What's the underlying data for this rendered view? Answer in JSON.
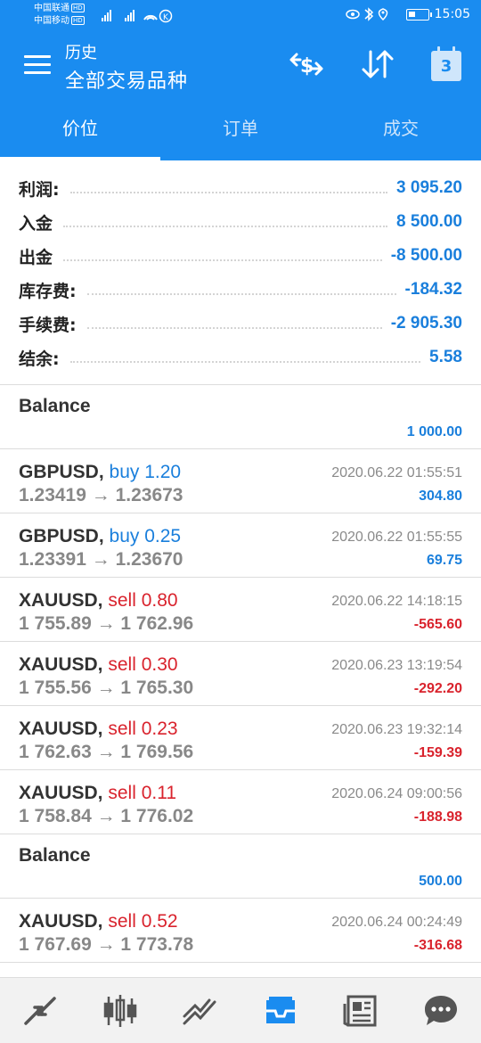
{
  "status_bar": {
    "carrier1": "中国联通",
    "carrier2": "中国移动",
    "hd": "HD",
    "time": "15:05"
  },
  "header": {
    "subtitle": "历史",
    "title": "全部交易品种",
    "calendar_day": "3",
    "icons": [
      "menu-icon",
      "symbols-exchange-icon",
      "sort-icon",
      "calendar-icon"
    ]
  },
  "tabs": [
    "价位",
    "订单",
    "成交"
  ],
  "summary": [
    {
      "label": "利润:",
      "value": "3 095.20"
    },
    {
      "label": "入金",
      "value": "8 500.00"
    },
    {
      "label": "出金",
      "value": "-8 500.00"
    },
    {
      "label": "库存费:",
      "value": "-184.32"
    },
    {
      "label": "手续费:",
      "value": "-2 905.30"
    },
    {
      "label": "结余:",
      "value": "5.58"
    }
  ],
  "deals": [
    {
      "type": "balance",
      "label": "Balance",
      "amount": "1 000.00"
    },
    {
      "type": "trade",
      "symbol": "GBPUSD,",
      "side": "buy 1.20",
      "direction": "buy",
      "prices": "1.23419 → 1.23673",
      "time": "2020.06.22 01:55:51",
      "profit": "304.80",
      "positive": true
    },
    {
      "type": "trade",
      "symbol": "GBPUSD,",
      "side": "buy 0.25",
      "direction": "buy",
      "prices": "1.23391 → 1.23670",
      "time": "2020.06.22 01:55:55",
      "profit": "69.75",
      "positive": true
    },
    {
      "type": "trade",
      "symbol": "XAUUSD,",
      "side": "sell 0.80",
      "direction": "sell",
      "prices": "1 755.89 → 1 762.96",
      "time": "2020.06.22 14:18:15",
      "profit": "-565.60",
      "positive": false
    },
    {
      "type": "trade",
      "symbol": "XAUUSD,",
      "side": "sell 0.30",
      "direction": "sell",
      "prices": "1 755.56 → 1 765.30",
      "time": "2020.06.23 13:19:54",
      "profit": "-292.20",
      "positive": false
    },
    {
      "type": "trade",
      "symbol": "XAUUSD,",
      "side": "sell 0.23",
      "direction": "sell",
      "prices": "1 762.63 → 1 769.56",
      "time": "2020.06.23 19:32:14",
      "profit": "-159.39",
      "positive": false
    },
    {
      "type": "trade",
      "symbol": "XAUUSD,",
      "side": "sell 0.11",
      "direction": "sell",
      "prices": "1 758.84 → 1 776.02",
      "time": "2020.06.24 09:00:56",
      "profit": "-188.98",
      "positive": false
    },
    {
      "type": "balance",
      "label": "Balance",
      "amount": "500.00"
    },
    {
      "type": "trade",
      "symbol": "XAUUSD,",
      "side": "sell 0.52",
      "direction": "sell",
      "prices": "1 767.69 → 1 773.78",
      "time": "2020.06.24 00:24:49",
      "profit": "-316.68",
      "positive": false
    }
  ],
  "bottom_nav": [
    {
      "icon": "quotes-icon",
      "active": false
    },
    {
      "icon": "chart-candles-icon",
      "active": false
    },
    {
      "icon": "trade-icon",
      "active": false
    },
    {
      "icon": "history-inbox-icon",
      "active": true
    },
    {
      "icon": "news-icon",
      "active": false
    },
    {
      "icon": "chat-icon",
      "active": false
    }
  ],
  "colors": {
    "accent": "#1a8cf0",
    "positive": "#1a7fdc",
    "negative": "#d9232d",
    "nav_inactive": "#555555"
  }
}
